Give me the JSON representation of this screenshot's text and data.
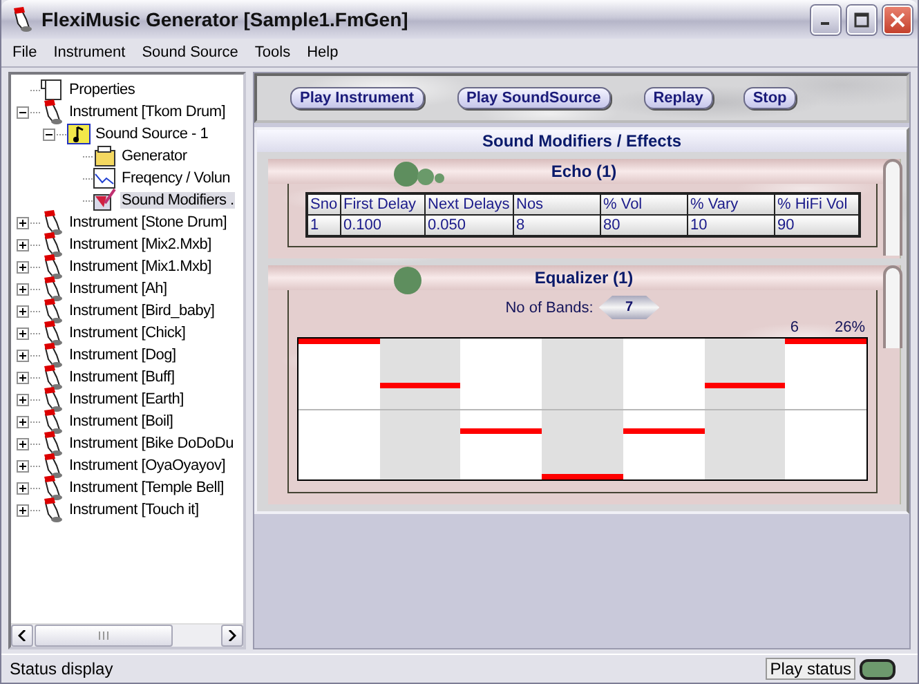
{
  "window": {
    "title": "FlexiMusic Generator [Sample1.FmGen]"
  },
  "menu": [
    "File",
    "Instrument",
    "Sound Source",
    "Tools",
    "Help"
  ],
  "tree": [
    {
      "label": "Properties",
      "kind": "properties",
      "selected": false
    },
    {
      "label": "Instrument [Tkom Drum]",
      "kind": "instrument",
      "expanded": true,
      "selected": false,
      "children": [
        {
          "label": "Sound Source - 1",
          "kind": "source",
          "expanded": true,
          "selected": false,
          "children": [
            {
              "label": "Generator",
              "kind": "generator",
              "selected": false
            },
            {
              "label": "Freqency / Volun",
              "kind": "graph",
              "selected": false
            },
            {
              "label": "Sound Modifiers .",
              "kind": "modifier",
              "selected": true
            }
          ]
        }
      ]
    },
    {
      "label": "Instrument [Stone Drum]",
      "kind": "instrument",
      "expanded": false,
      "selected": false
    },
    {
      "label": "Instrument [Mix2.Mxb]",
      "kind": "instrument",
      "expanded": false,
      "selected": false
    },
    {
      "label": "Instrument [Mix1.Mxb]",
      "kind": "instrument",
      "expanded": false,
      "selected": false
    },
    {
      "label": "Instrument [Ah]",
      "kind": "instrument",
      "expanded": false,
      "selected": false
    },
    {
      "label": "Instrument [Bird_baby]",
      "kind": "instrument",
      "expanded": false,
      "selected": false
    },
    {
      "label": "Instrument [Chick]",
      "kind": "instrument",
      "expanded": false,
      "selected": false
    },
    {
      "label": "Instrument [Dog]",
      "kind": "instrument",
      "expanded": false,
      "selected": false
    },
    {
      "label": "Instrument [Buff]",
      "kind": "instrument",
      "expanded": false,
      "selected": false
    },
    {
      "label": "Instrument [Earth]",
      "kind": "instrument",
      "expanded": false,
      "selected": false
    },
    {
      "label": "Instrument [Boil]",
      "kind": "instrument",
      "expanded": false,
      "selected": false
    },
    {
      "label": "Instrument [Bike DoDoDu",
      "kind": "instrument",
      "expanded": false,
      "selected": false
    },
    {
      "label": "Instrument [OyaOyayov]",
      "kind": "instrument",
      "expanded": false,
      "selected": false
    },
    {
      "label": "Instrument [Temple Bell]",
      "kind": "instrument",
      "expanded": false,
      "selected": false
    },
    {
      "label": "Instrument [Touch it]",
      "kind": "instrument",
      "expanded": false,
      "selected": false
    }
  ],
  "toolbar": {
    "buttons": [
      "Play Instrument",
      "Play SoundSource",
      "Replay",
      "Stop"
    ]
  },
  "effects": {
    "title": "Sound Modifiers / Effects",
    "echo": {
      "title": "Echo (1)",
      "columns": [
        "Sno",
        "First Delay",
        "Next Delays",
        "Nos",
        "% Vol",
        "% Vary",
        "% HiFi Vol"
      ],
      "rows": [
        [
          "1",
          "0.100",
          "0.050",
          "8",
          "80",
          "10",
          "90"
        ]
      ]
    },
    "equalizer": {
      "title": "Equalizer (1)",
      "bands_label": "No of Bands:",
      "bands_value": "7",
      "band_number": "6",
      "band_value": "26%",
      "bands": [
        {
          "level": 1
        },
        {
          "level": 0.67
        },
        {
          "level": 0.34
        },
        {
          "level": 0
        },
        {
          "level": 0.34
        },
        {
          "level": 0.67
        },
        {
          "level": 1
        }
      ]
    }
  },
  "status_bar": {
    "text": "Status display",
    "play_label": "Play status"
  }
}
